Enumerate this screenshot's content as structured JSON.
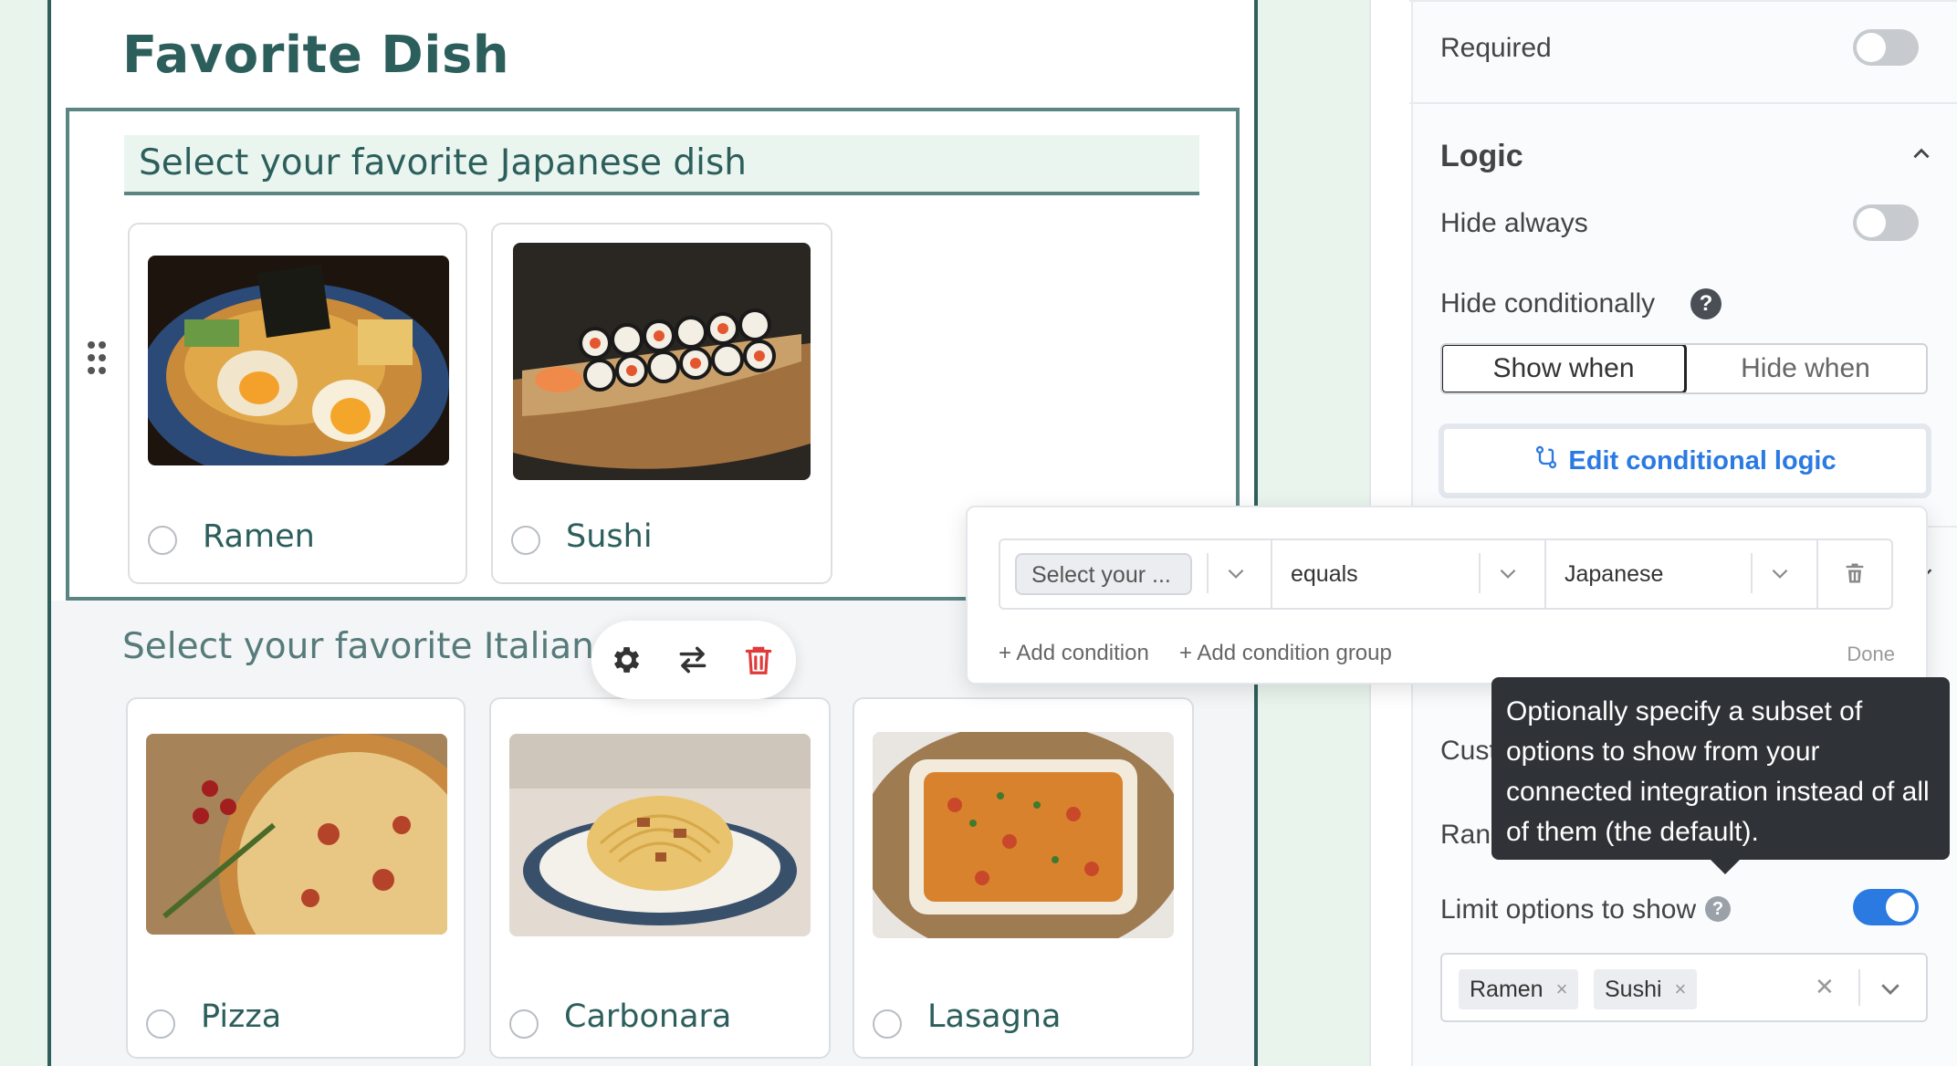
{
  "form": {
    "title": "Favorite Dish",
    "q1": {
      "heading": "Select your favorite Japanese dish",
      "options": [
        {
          "label": "Ramen"
        },
        {
          "label": "Sushi"
        }
      ]
    },
    "q2": {
      "heading": "Select your favorite Italian di",
      "options": [
        {
          "label": "Pizza"
        },
        {
          "label": "Carbonara"
        },
        {
          "label": "Lasagna"
        }
      ]
    }
  },
  "toolbar": {
    "icons": [
      "gear-icon",
      "swap-icon",
      "trash-icon"
    ]
  },
  "sidebar": {
    "required_label": "Required",
    "logic_heading": "Logic",
    "hide_always_label": "Hide always",
    "hide_conditionally_label": "Hide conditionally",
    "help_glyph": "?",
    "segments": [
      "Show when",
      "Hide when"
    ],
    "edit_logic_label": "Edit conditional logic",
    "custom_prefix": "Cust",
    "random_prefix": "Rand",
    "limit_options_label": "Limit options to show",
    "selected_options": [
      "Ramen",
      "Sushi"
    ],
    "tag_remove": "×",
    "clear_glyph": "✕"
  },
  "logic_popover": {
    "field": "Select your ...",
    "operator": "equals",
    "value": "Japanese",
    "add_condition": "+ Add condition",
    "add_group": "+ Add condition group",
    "done": "Done"
  },
  "tooltip": {
    "lines": [
      "Optionally specify a subset of",
      "options to show from your",
      "connected integration instead of all",
      "of them (the default)."
    ]
  },
  "colors": {
    "brand_teal": "#2c5f5c",
    "accent_blue": "#2a7ae2",
    "delete_red": "#e03a3a"
  }
}
